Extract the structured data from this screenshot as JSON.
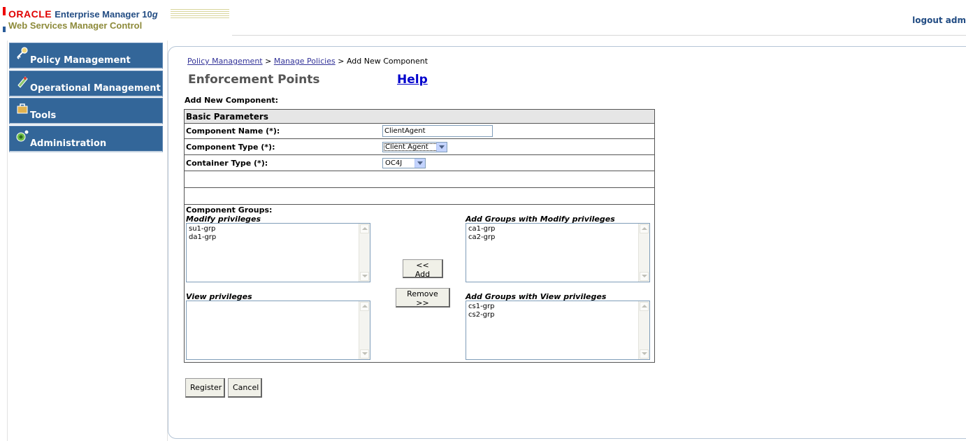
{
  "header": {
    "oracle": "ORACLE",
    "product": "Enterprise Manager 10",
    "product_g": "g",
    "subtitle": "Web Services Manager Control",
    "logout": "logout adm"
  },
  "sidebar": {
    "items": [
      {
        "label": "Policy Management",
        "icon": "key-icon"
      },
      {
        "label": "Operational Management",
        "icon": "gauge-icon"
      },
      {
        "label": "Tools",
        "icon": "toolbox-icon"
      },
      {
        "label": "Administration",
        "icon": "people-gear-icon"
      }
    ]
  },
  "breadcrumb": {
    "item1": "Policy Management",
    "sep1": " > ",
    "item2": "Manage Policies",
    "sep2": " > ",
    "current": "Add New Component"
  },
  "page": {
    "title": "Enforcement Points",
    "help": "Help",
    "subheading": "Add New Component:"
  },
  "form": {
    "section": "Basic Parameters",
    "component_name_label": "Component Name (*):",
    "component_name_value": "ClientAgent",
    "component_type_label": "Component Type (*):",
    "component_type_value": "Client Agent",
    "container_type_label": "Container Type (*):",
    "container_type_value": "OC4J",
    "groups_label": "Component Groups:",
    "modify_label": "Modify privileges",
    "modify_items": [
      "su1-grp",
      "da1-grp"
    ],
    "view_label": "View privileges",
    "view_items": [],
    "add_modify_label": "Add Groups with Modify privileges",
    "add_modify_items": [
      "ca1-grp",
      "ca2-grp"
    ],
    "add_view_label": "Add Groups with View privileges",
    "add_view_items": [
      "cs1-grp",
      "cs2-grp"
    ],
    "add_button": "<<  Add",
    "remove_button": "Remove >>"
  },
  "actions": {
    "register": "Register",
    "cancel": "Cancel"
  }
}
